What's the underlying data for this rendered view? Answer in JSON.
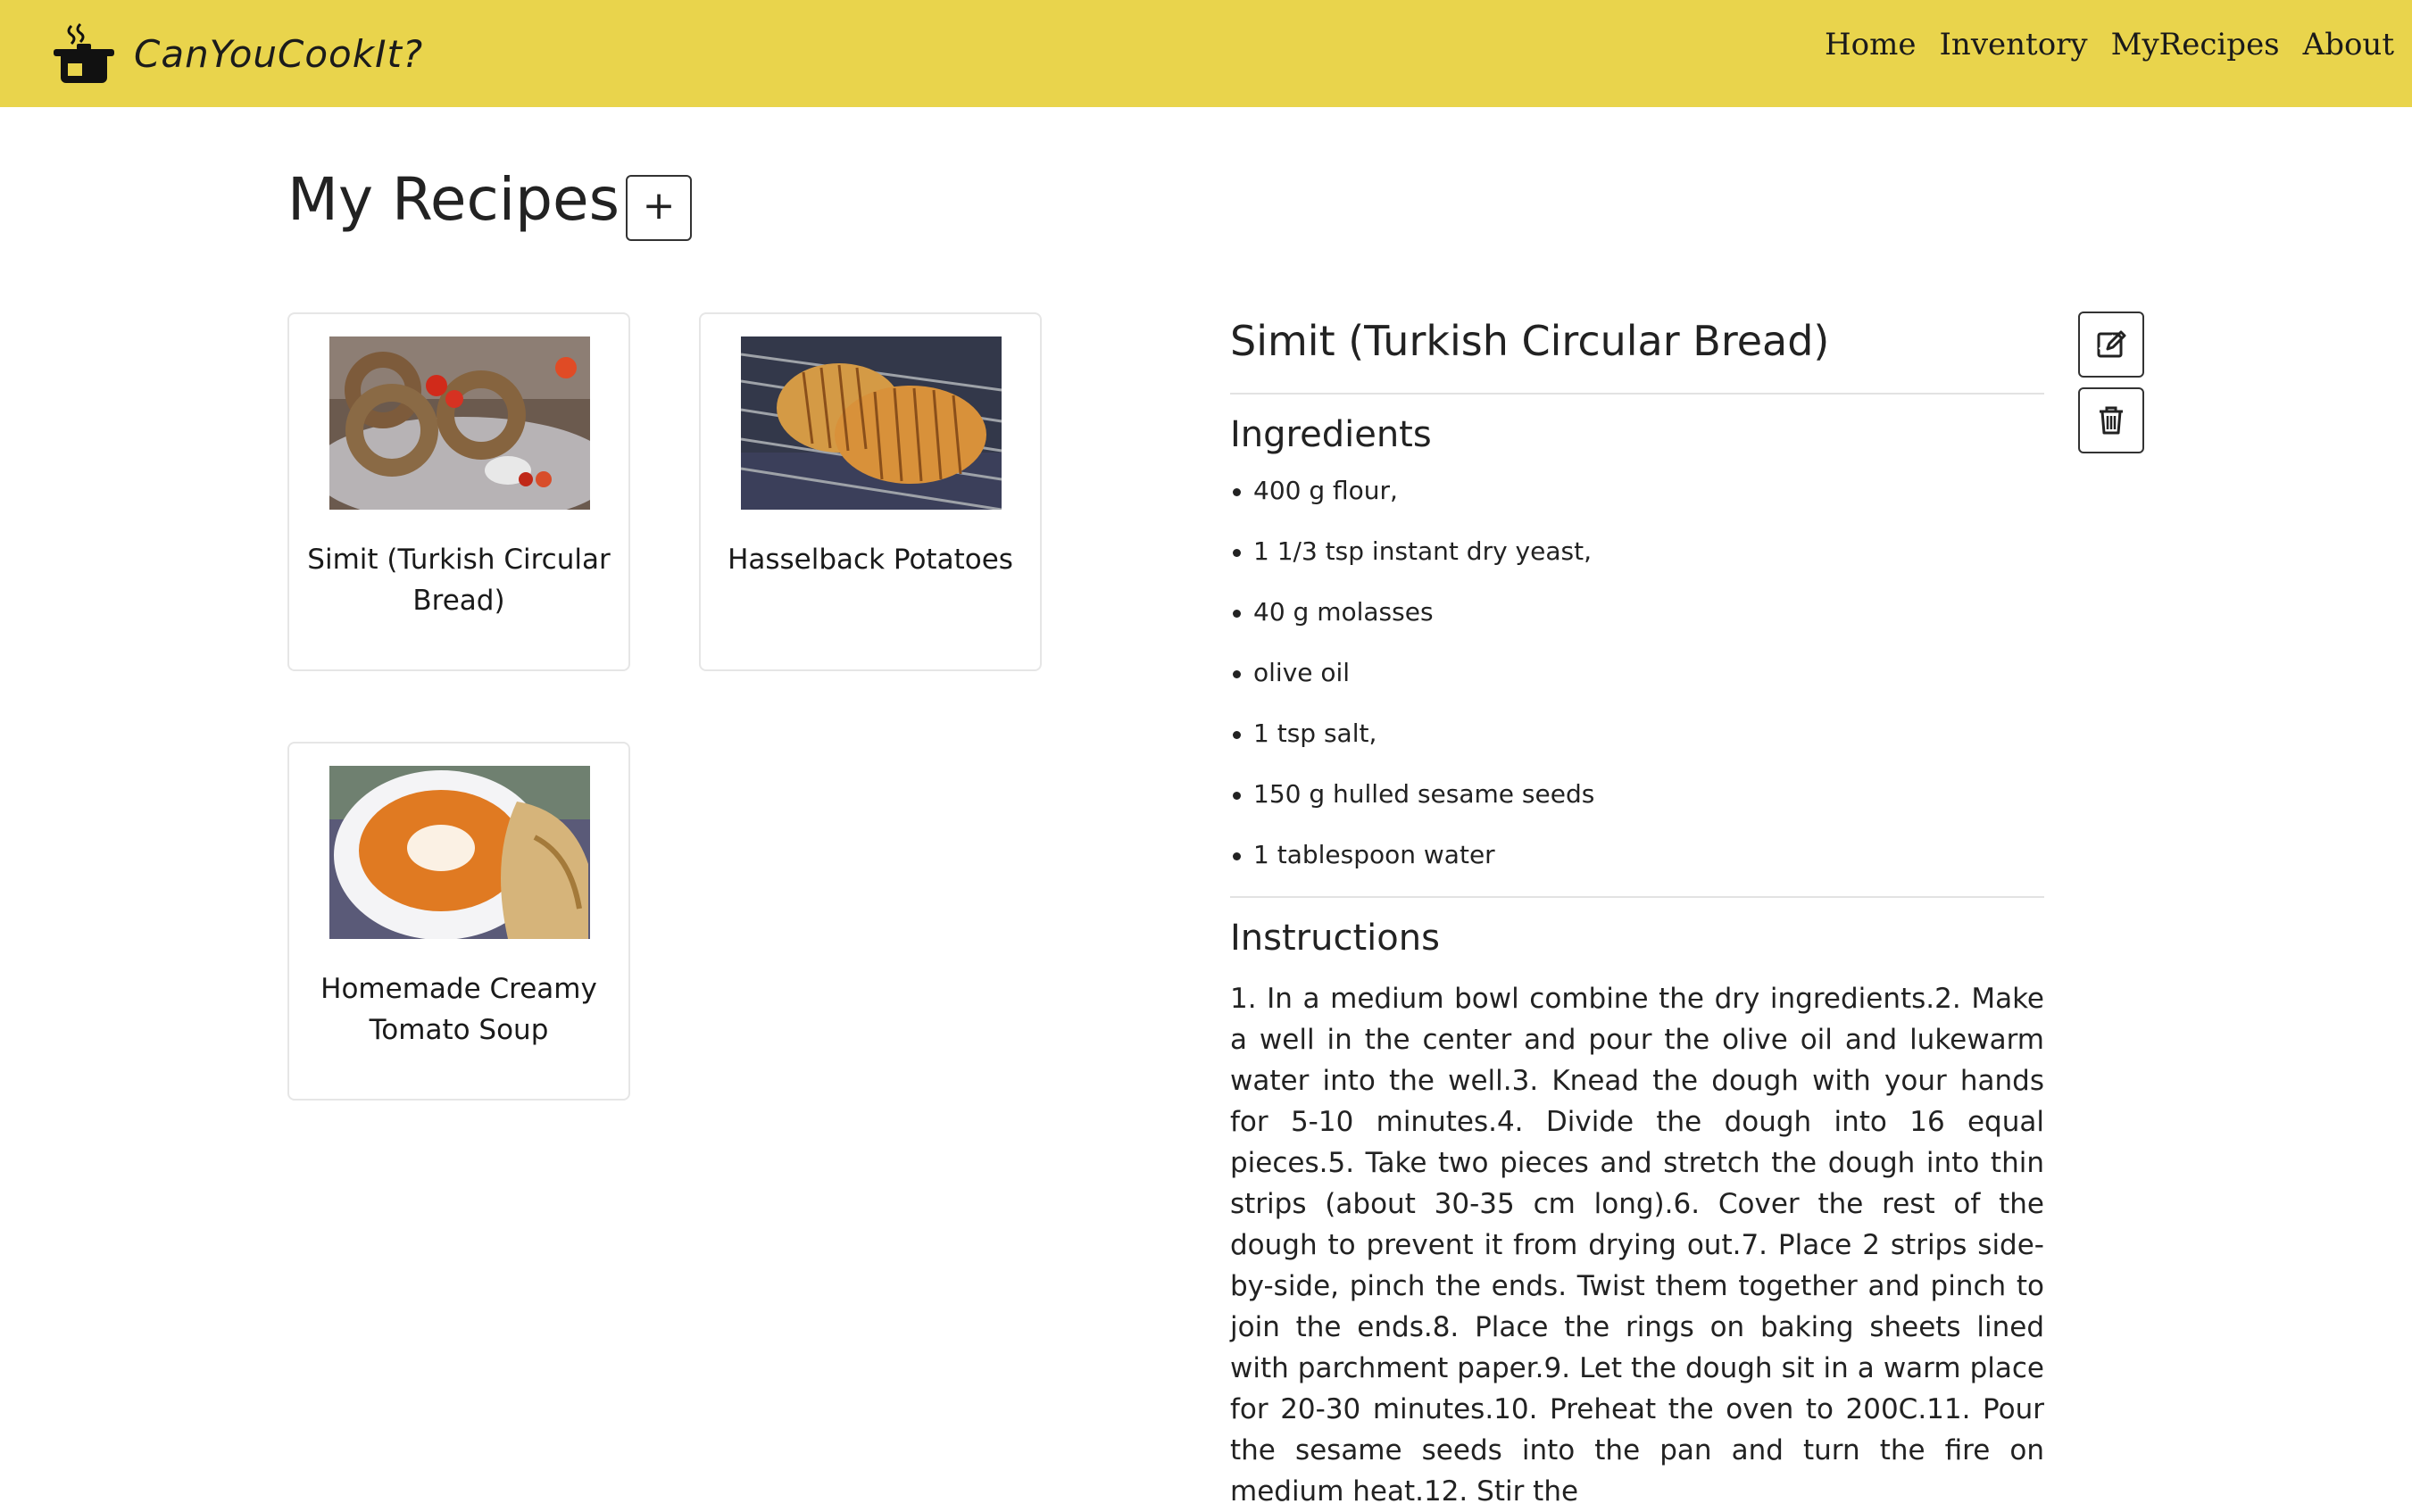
{
  "navbar": {
    "brand": "CanYouCookIt?",
    "links": [
      "Home",
      "Inventory",
      "MyRecipes",
      "About"
    ]
  },
  "page": {
    "title": "My Recipes",
    "add_label": "+"
  },
  "recipes": [
    {
      "title": "Simit (Turkish Circular Bread)",
      "image": "simit-photo"
    },
    {
      "title": "Hasselback Potatoes",
      "image": "hasselback-potatoes-photo"
    },
    {
      "title": "Homemade Creamy Tomato Soup",
      "image": "tomato-soup-photo"
    }
  ],
  "detail": {
    "title": "Simit (Turkish Circular Bread)",
    "ingredients_heading": "Ingredients",
    "ingredients": [
      "400 g flour,",
      "1 1/3 tsp instant dry yeast,",
      "40 g molasses",
      "olive oil",
      "1 tsp salt,",
      "150 g hulled sesame seeds",
      "1 tablespoon water"
    ],
    "instructions_heading": "Instructions",
    "instructions": "1. In a medium bowl combine the dry ingredients.2. Make a well in the center and pour the olive oil and lukewarm water into the well.3. Knead the dough with your hands for 5-10 minutes.4. Divide the dough into 16 equal pieces.5. Take two pieces and stretch the dough into thin strips (about 30-35 cm long).6. Cover the rest of the dough to prevent it from drying out.7. Place 2 strips side-by-side, pinch the ends. Twist them together and pinch to join the ends.8. Place the rings on baking sheets lined with parchment paper.9. Let the dough sit in a warm place for 20-30 minutes.10. Preheat the oven to 200C.11. Pour the sesame seeds into the pan and turn the fire on medium heat.12. Stir the",
    "edit_icon": "edit-icon",
    "delete_icon": "trash-icon"
  },
  "colors": {
    "navbar_bg": "#e9d44c",
    "text": "#222222",
    "border": "#e6e6e6"
  }
}
